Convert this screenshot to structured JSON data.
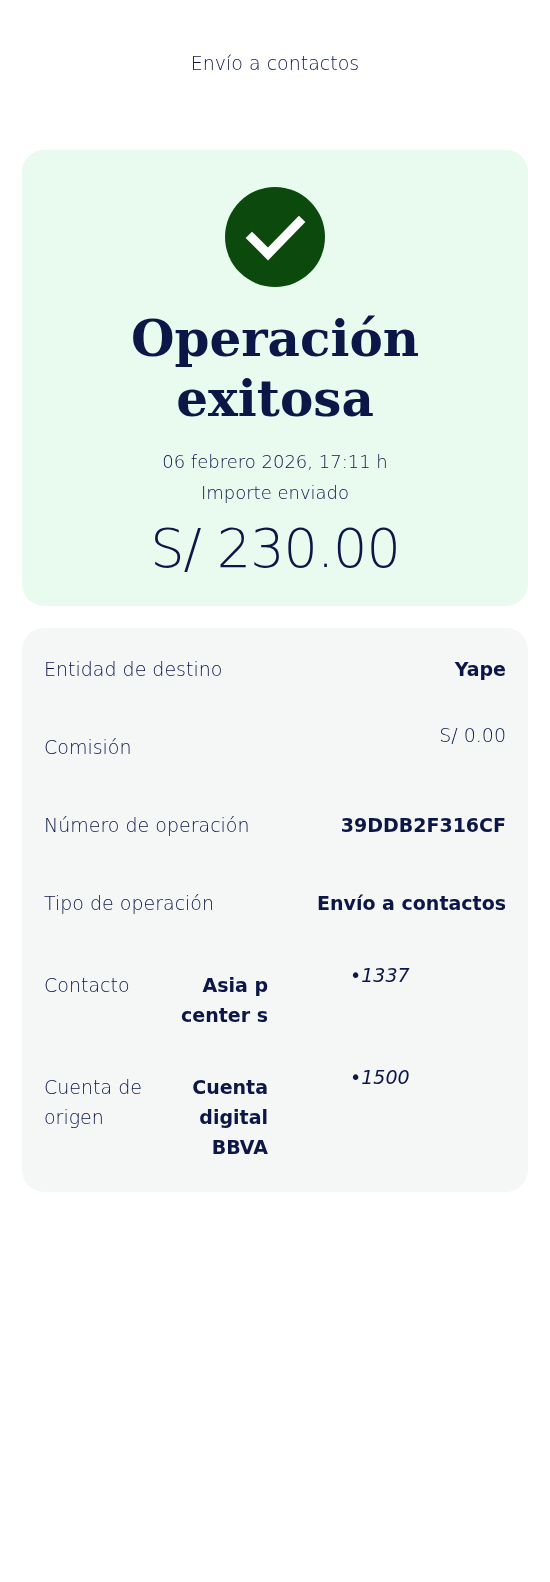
{
  "header": {
    "title": "Envío a contactos"
  },
  "summary": {
    "title": "Operación exitosa",
    "datetime": "06 febrero 2026, 17:11 h",
    "amount_label": "Importe enviado",
    "amount": "S/ 230.00"
  },
  "details": [
    {
      "kind": "plain",
      "label": "Entidad de destino",
      "value": "Yape",
      "bold": true
    },
    {
      "kind": "plain",
      "label": "Comisión",
      "value": "S/ 0.00",
      "bold": false
    },
    {
      "kind": "plain",
      "label": "Número de operación",
      "value": "39DDB2F316CF",
      "bold": true
    },
    {
      "kind": "plain",
      "label": "Tipo de operación",
      "value": "Envío a contactos",
      "bold": true
    },
    {
      "kind": "account",
      "label": "Contacto",
      "value": "Asia p center s",
      "number": "•1337"
    },
    {
      "kind": "account",
      "label": "Cuenta de origen",
      "value": "Cuenta digital BBVA",
      "number": "•1500"
    }
  ]
}
